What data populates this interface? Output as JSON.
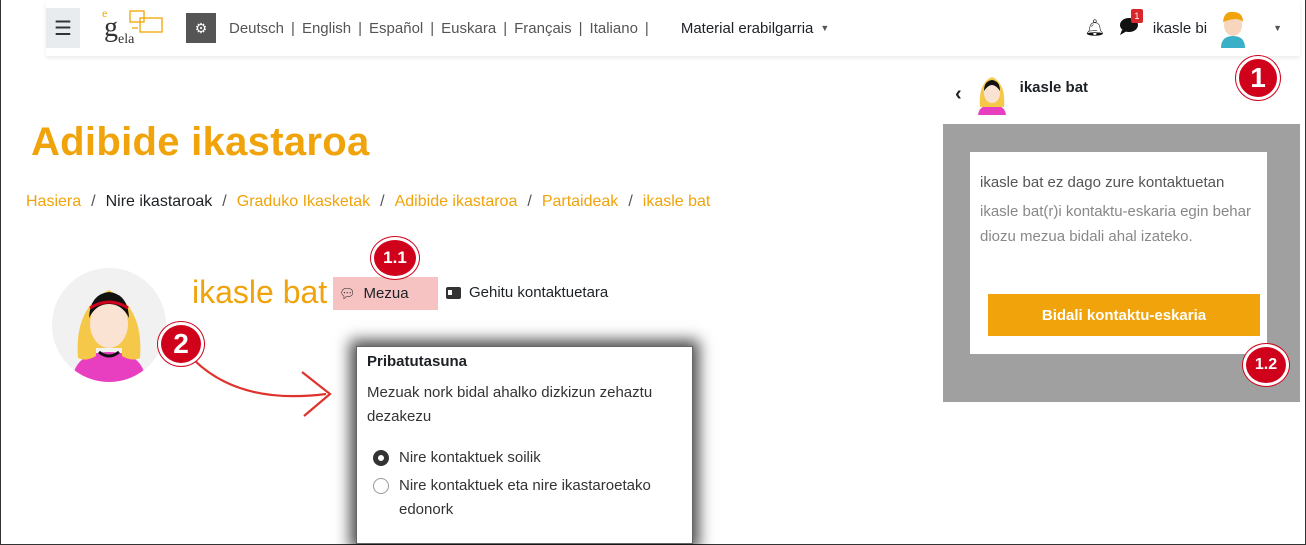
{
  "navbar": {
    "logo_text": "g",
    "logo_sub": "ela",
    "logo_e": "e",
    "languages": [
      "Deutsch",
      "English",
      "Español",
      "Euskara",
      "Français",
      "Italiano"
    ],
    "material_label": "Material erabilgarria",
    "message_badge": "1",
    "username": "ikasle bi"
  },
  "markers": {
    "m1": "1",
    "m11": "1.1",
    "m12": "1.2",
    "m2": "2"
  },
  "page": {
    "title": "Adibide ikastaroa",
    "breadcrumb": [
      "Hasiera",
      "Nire ikastaroak",
      "Graduko Ikasketak",
      "Adibide ikastaroa",
      "Partaideak",
      "ikasle bat"
    ],
    "profile_name": "ikasle bat",
    "message_button": "Mezua",
    "add_contact": "Gehitu kontaktuetara"
  },
  "privacy": {
    "title": "Pribatutasuna",
    "description": "Mezuak nork bidal ahalko dizkizun zehaztu dezakezu",
    "options": [
      "Nire kontaktuek soilik",
      "Nire kontaktuek eta nire ikastaroetako edonork"
    ],
    "selected": 0
  },
  "drawer": {
    "name": "ikasle bat",
    "not_contact": "ikasle bat ez dago zure kontaktuetan",
    "hint": "ikasle bat(r)i kontaktu-eskaria egin behar diozu mezua bidali ahal izateko.",
    "send_button": "Bidali kontaktu-eskaria"
  },
  "colors": {
    "accent": "#f0a30a",
    "marker": "#d0021b",
    "highlight": "#f6c2c2",
    "drawer_bg": "#a0a0a0"
  }
}
